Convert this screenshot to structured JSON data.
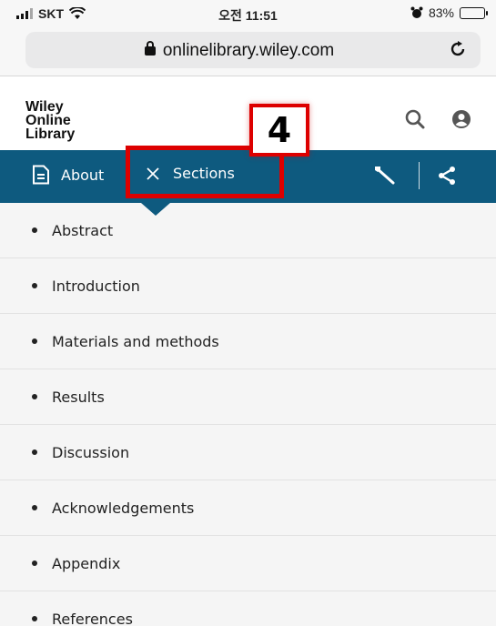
{
  "status_bar": {
    "carrier": "SKT",
    "time": "오전 11:51",
    "battery_percent": "83%",
    "battery_level": 0.83
  },
  "url_bar": {
    "domain": "onlinelibrary.wiley.com"
  },
  "header": {
    "logo_line1": "Wiley",
    "logo_line2": "Online",
    "logo_line3": "Library"
  },
  "annotation": {
    "number": "4"
  },
  "nav": {
    "about_label": "About",
    "sections_label": "Sections"
  },
  "sections": [
    "Abstract",
    "Introduction",
    "Materials and methods",
    "Results",
    "Discussion",
    "Acknowledgements",
    "Appendix",
    "References"
  ],
  "colors": {
    "nav_background": "#0e5a7f",
    "highlight": "#dd0000",
    "list_background": "#f5f5f5"
  },
  "icons": {
    "lock": "lock-icon",
    "reload": "reload-icon",
    "search": "search-icon",
    "user": "user-icon",
    "about": "document-icon",
    "close": "close-icon",
    "tools": "wrench-icon",
    "share": "share-icon"
  }
}
